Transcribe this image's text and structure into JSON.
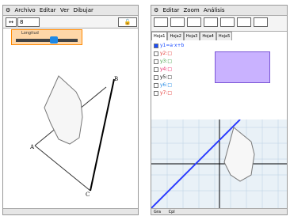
{
  "left_window": {
    "menu": [
      "Archivo",
      "Editar",
      "Ver",
      "Dibujar"
    ],
    "toolbar": {
      "value_field": "8"
    },
    "slider": {
      "title": "Longitud"
    },
    "points": [
      "A",
      "B",
      "C"
    ]
  },
  "right_window": {
    "menu": [
      "Editar",
      "Zoom",
      "Análisis"
    ],
    "tabs": [
      "Hoja1",
      "Hoja2",
      "Hoja3",
      "Hoja4",
      "Hoja5"
    ],
    "functions": [
      {
        "label": "y1=a·x+b",
        "color": "#1a4cff",
        "checked": true
      },
      {
        "label": "y2:□",
        "color": "#e53935",
        "checked": false
      },
      {
        "label": "y3:□",
        "color": "#43a047",
        "checked": false
      },
      {
        "label": "y4:□",
        "color": "#e91e63",
        "checked": false
      },
      {
        "label": "y5:□",
        "color": "#000000",
        "checked": false
      },
      {
        "label": "y6:□",
        "color": "#1e88e5",
        "checked": false
      },
      {
        "label": "y7:□",
        "color": "#e53935",
        "checked": false
      }
    ],
    "status": [
      "Gra",
      "Cpl"
    ]
  },
  "colors": {
    "accent": "#1e88e5",
    "menu_bg": "#e6e6e6"
  }
}
